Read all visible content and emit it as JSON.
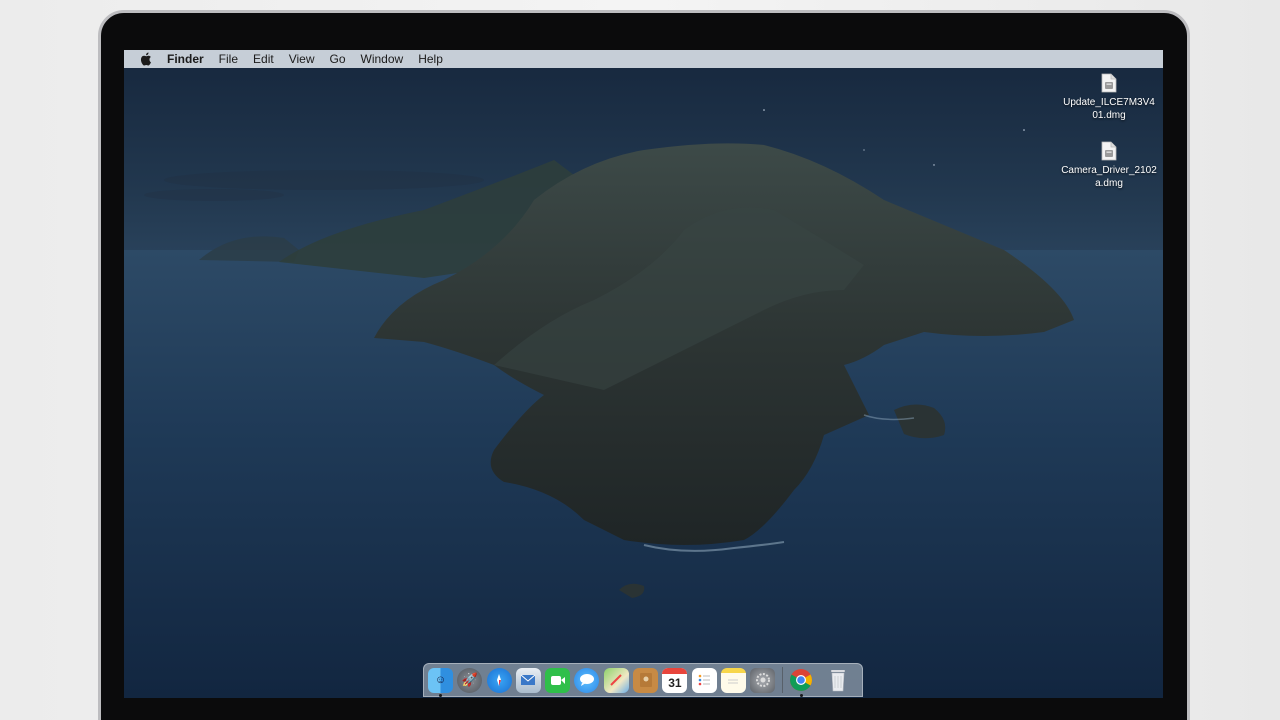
{
  "menubar": {
    "app_name": "Finder",
    "items": [
      "File",
      "Edit",
      "View",
      "Go",
      "Window",
      "Help"
    ]
  },
  "desktop": {
    "icons": [
      {
        "label": "Update_ILCE7M3V401.dmg",
        "icon": "disk-image-file-icon"
      },
      {
        "label": "Camera_Driver_2102a.dmg",
        "icon": "disk-image-file-icon"
      }
    ]
  },
  "dock": {
    "apps": [
      {
        "name": "finder-icon",
        "running": true
      },
      {
        "name": "launchpad-icon",
        "running": false
      },
      {
        "name": "safari-icon",
        "running": false
      },
      {
        "name": "mail-icon",
        "running": false
      },
      {
        "name": "facetime-icon",
        "running": false
      },
      {
        "name": "messages-icon",
        "running": false
      },
      {
        "name": "maps-icon",
        "running": false
      },
      {
        "name": "contacts-icon",
        "running": false
      },
      {
        "name": "calendar-icon",
        "running": false,
        "text": "31"
      },
      {
        "name": "reminders-icon",
        "running": false
      },
      {
        "name": "notes-icon",
        "running": false
      },
      {
        "name": "system-preferences-icon",
        "running": false
      },
      {
        "name": "chrome-icon",
        "running": true
      },
      {
        "name": "trash-icon",
        "running": false
      }
    ]
  },
  "colors": {
    "menubar": "#d6dce4",
    "sea": "#1b3450",
    "sky": "#16273d"
  }
}
